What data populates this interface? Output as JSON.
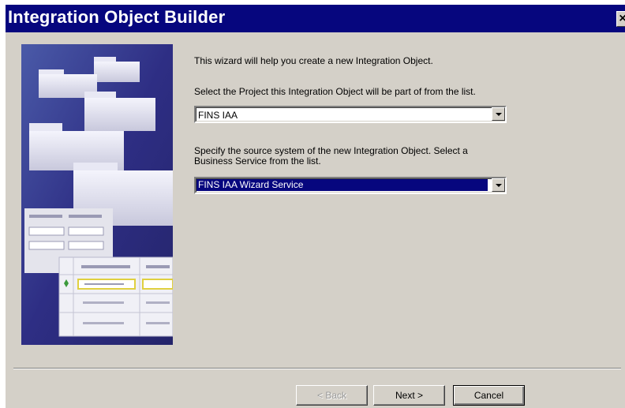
{
  "window": {
    "title": "Integration Object Builder",
    "close_glyph": "×"
  },
  "wizard": {
    "intro": "This wizard will help you create a new Integration Object.",
    "project_prompt": "Select the Project this Integration Object will be part of from the list.",
    "project_value": "FINS IAA",
    "source_prompt_line1": "Specify the source system of the new Integration Object. Select a",
    "source_prompt_line2": "Business Service from the list.",
    "source_value": "FINS IAA Wizard Service"
  },
  "buttons": {
    "back": "< Back",
    "next": "Next >",
    "cancel": "Cancel"
  },
  "colors": {
    "titlebar": "#06067e",
    "dialog_bg": "#d4d0c8",
    "illustration_bg": "#2e2e84",
    "selection": "#06067e"
  },
  "icons": [
    "close-icon",
    "dropdown-arrow-icon",
    "wizard-illustration"
  ]
}
